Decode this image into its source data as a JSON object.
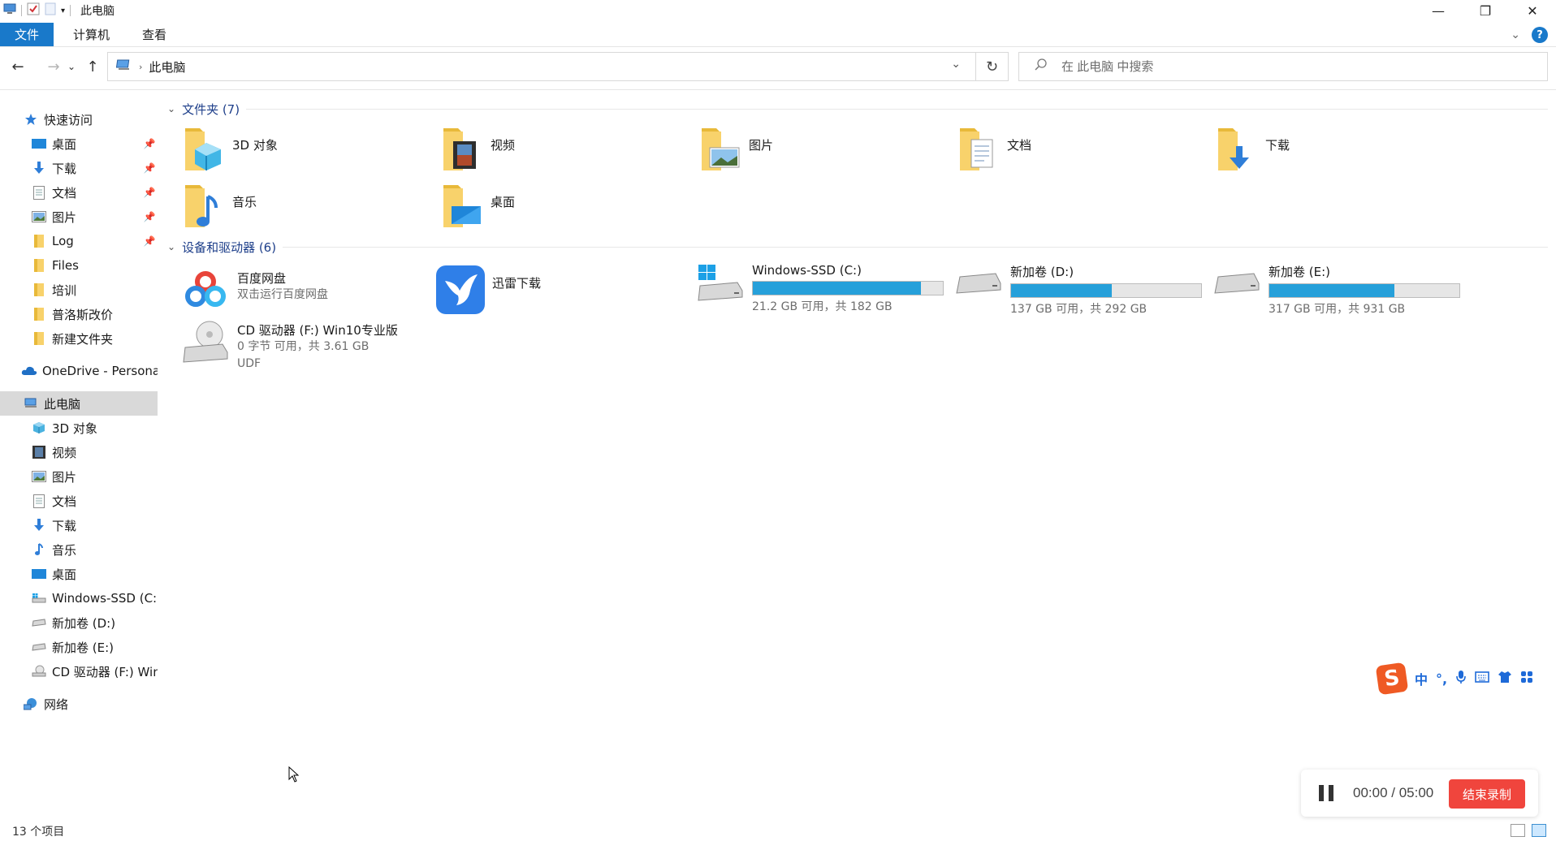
{
  "window": {
    "title": "此电脑"
  },
  "ribbon": {
    "tabs": [
      "文件",
      "计算机",
      "查看"
    ],
    "help_label": "?"
  },
  "address": {
    "path": "此电脑",
    "refresh_label": "↻"
  },
  "search": {
    "placeholder": "在 此电脑 中搜索"
  },
  "sidebar": {
    "quick_access": "快速访问",
    "quick_items": [
      {
        "label": "桌面",
        "icon": "desktop-icon",
        "pinned": true
      },
      {
        "label": "下载",
        "icon": "download-icon",
        "pinned": true
      },
      {
        "label": "文档",
        "icon": "document-icon",
        "pinned": true
      },
      {
        "label": "图片",
        "icon": "picture-icon",
        "pinned": true
      },
      {
        "label": "Log",
        "icon": "folder-icon",
        "pinned": true
      },
      {
        "label": "Files",
        "icon": "folder-icon",
        "pinned": false
      },
      {
        "label": "培训",
        "icon": "folder-icon",
        "pinned": false
      },
      {
        "label": "普洛斯改价",
        "icon": "folder-icon",
        "pinned": false
      },
      {
        "label": "新建文件夹",
        "icon": "folder-icon",
        "pinned": false
      }
    ],
    "onedrive": "OneDrive - Persona",
    "this_pc": "此电脑",
    "pc_items": [
      {
        "label": "3D 对象",
        "icon": "3d-objects-icon"
      },
      {
        "label": "视频",
        "icon": "video-icon"
      },
      {
        "label": "图片",
        "icon": "picture-icon"
      },
      {
        "label": "文档",
        "icon": "document-icon"
      },
      {
        "label": "下载",
        "icon": "download-icon"
      },
      {
        "label": "音乐",
        "icon": "music-icon"
      },
      {
        "label": "桌面",
        "icon": "desktop-icon"
      },
      {
        "label": "Windows-SSD (C:)",
        "icon": "windows-drive-icon"
      },
      {
        "label": "新加卷 (D:)",
        "icon": "drive-icon"
      },
      {
        "label": "新加卷 (E:)",
        "icon": "drive-icon"
      },
      {
        "label": "CD 驱动器 (F:) Win",
        "icon": "cd-drive-icon"
      }
    ],
    "network": "网络"
  },
  "content": {
    "folders_header": "文件夹 (7)",
    "folders": [
      {
        "label": "3D 对象",
        "icon": "3d-objects-icon"
      },
      {
        "label": "视频",
        "icon": "video-icon"
      },
      {
        "label": "图片",
        "icon": "picture-icon"
      },
      {
        "label": "文档",
        "icon": "document-icon"
      },
      {
        "label": "下载",
        "icon": "download-icon"
      },
      {
        "label": "音乐",
        "icon": "music-icon"
      },
      {
        "label": "桌面",
        "icon": "desktop-icon"
      }
    ],
    "devices_header": "设备和驱动器 (6)",
    "apps": [
      {
        "name": "百度网盘",
        "sub": "双击运行百度网盘",
        "icon": "baidu-netdisk-icon"
      },
      {
        "name": "迅雷下载",
        "icon": "xunlei-icon"
      }
    ],
    "drives": [
      {
        "name": "Windows-SSD (C:)",
        "free": "21.2 GB 可用，共 182 GB",
        "used_fraction": 0.884,
        "icon": "windows-drive-icon"
      },
      {
        "name": "新加卷 (D:)",
        "free": "137 GB 可用，共 292 GB",
        "used_fraction": 0.531,
        "icon": "drive-icon"
      },
      {
        "name": "新加卷 (E:)",
        "free": "317 GB 可用，共 931 GB",
        "used_fraction": 0.66,
        "icon": "drive-icon"
      }
    ],
    "cd": {
      "name": "CD 驱动器 (F:) Win10专业版",
      "free": "0 字节 可用，共 3.61 GB",
      "fs": "UDF"
    }
  },
  "status": {
    "count": "13 个项目"
  },
  "ime": {
    "logo": "S",
    "mode": "中",
    "punct": "°,"
  },
  "recorder": {
    "time": "00:00 / 05:00",
    "stop_label": "结束录制"
  },
  "colors": {
    "accent": "#1979ca",
    "bar_fill": "#26a0da",
    "folder": "#f8d26b",
    "stop_button": "#f0453d"
  }
}
